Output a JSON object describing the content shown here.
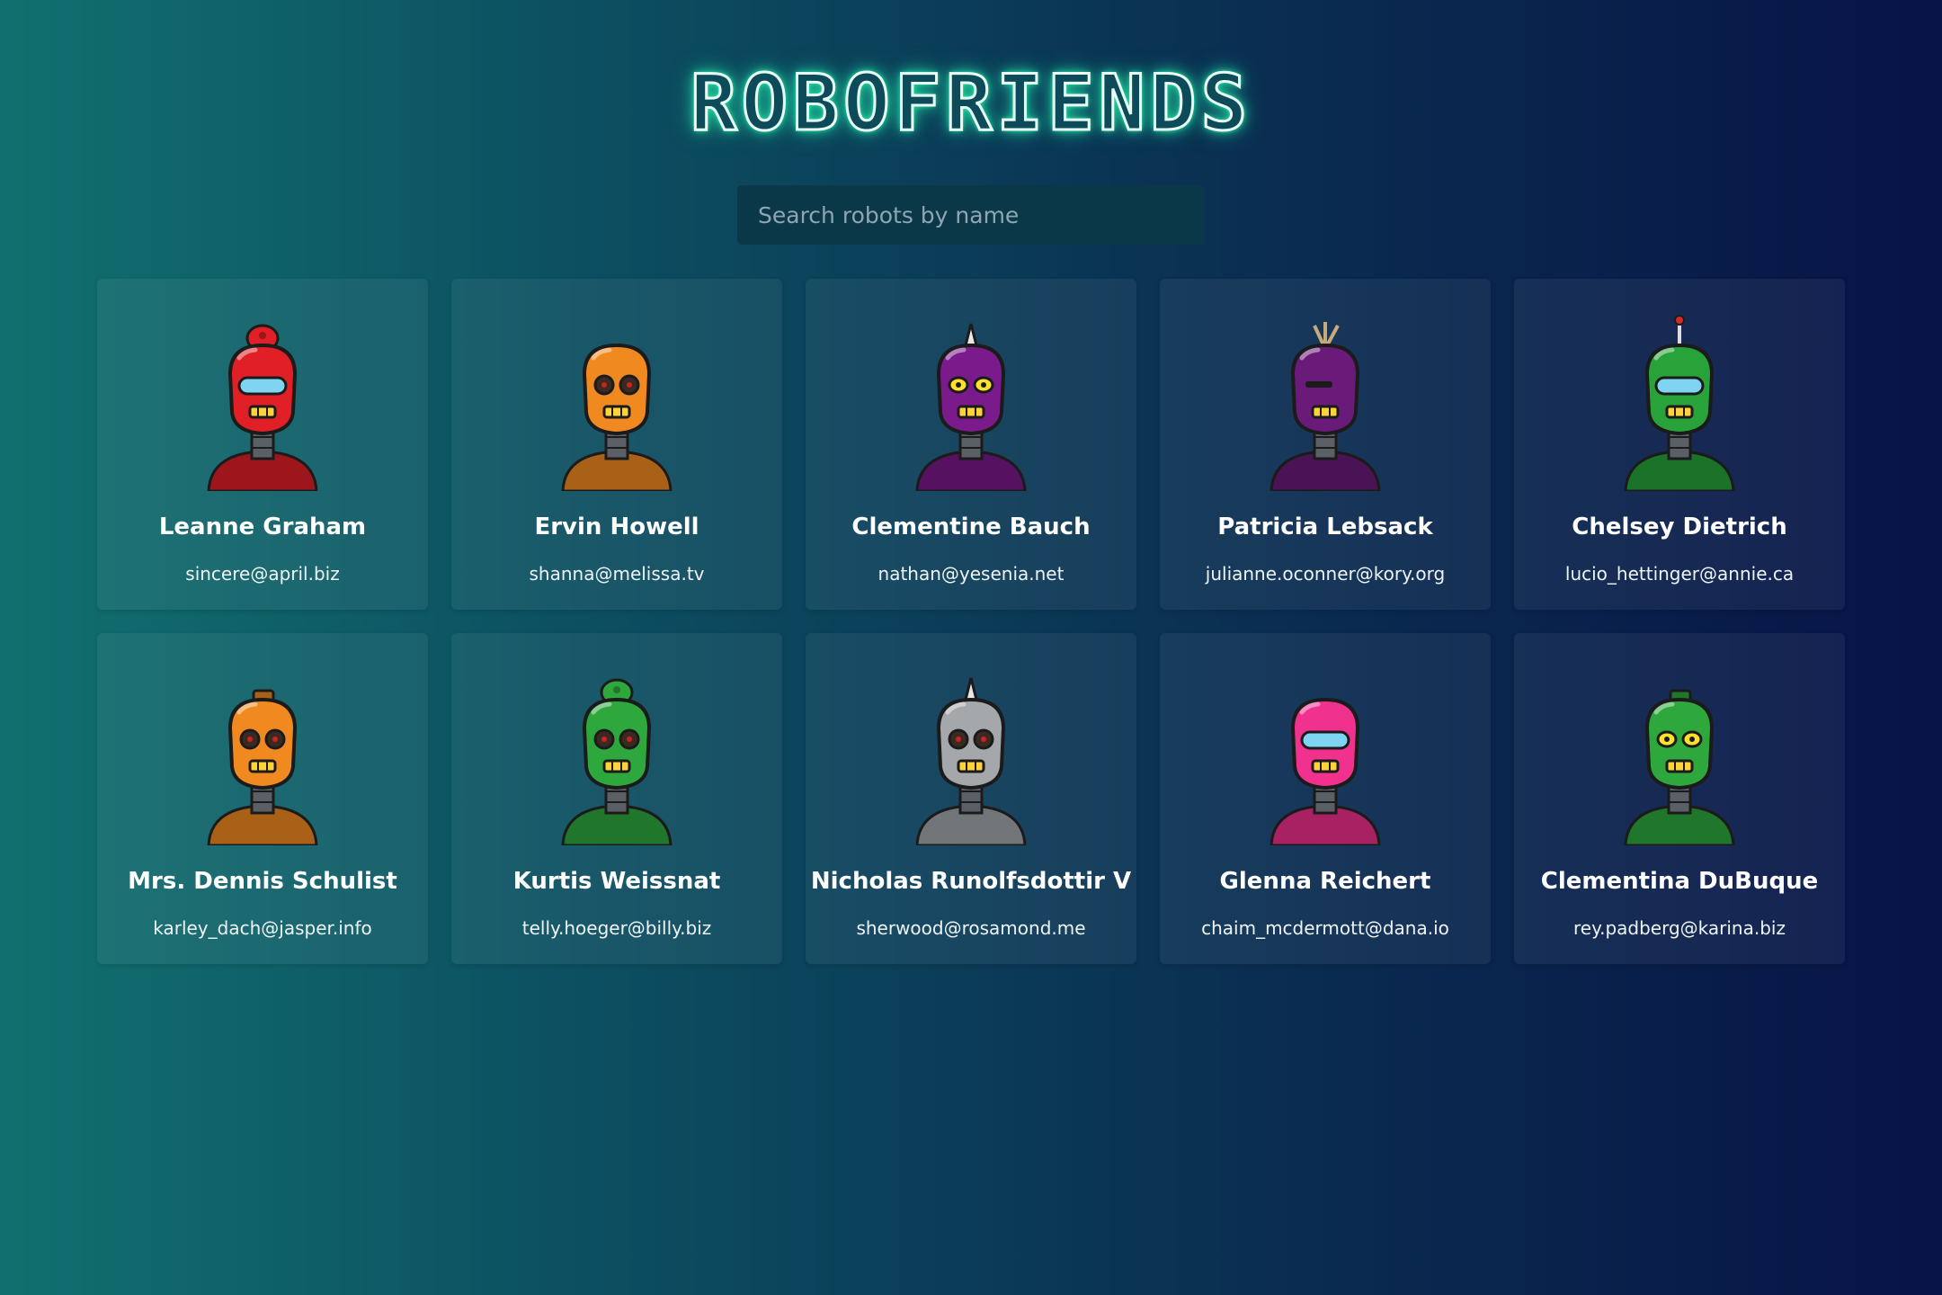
{
  "app": {
    "title": "ROBOFRIENDS"
  },
  "search": {
    "placeholder": "Search robots by name",
    "value": ""
  },
  "robots": [
    {
      "name": "Leanne Graham",
      "email": "sincere@april.biz",
      "color": "#e01f27",
      "eyes": "visor",
      "topper": "dome"
    },
    {
      "name": "Ervin Howell",
      "email": "shanna@melissa.tv",
      "color": "#f08a20",
      "eyes": "dots",
      "topper": "none"
    },
    {
      "name": "Clementine Bauch",
      "email": "nathan@yesenia.net",
      "color": "#7b1a8a",
      "eyes": "yellow",
      "topper": "spike"
    },
    {
      "name": "Patricia Lebsack",
      "email": "julianne.oconner@kory.org",
      "color": "#6a1b7a",
      "eyes": "slit",
      "topper": "wires"
    },
    {
      "name": "Chelsey Dietrich",
      "email": "lucio_hettinger@annie.ca",
      "color": "#27a33a",
      "eyes": "visor",
      "topper": "antenna"
    },
    {
      "name": "Mrs. Dennis Schulist",
      "email": "karley_dach@jasper.info",
      "color": "#f08a20",
      "eyes": "dots",
      "topper": "box"
    },
    {
      "name": "Kurtis Weissnat",
      "email": "telly.hoeger@billy.biz",
      "color": "#2ea83d",
      "eyes": "dots",
      "topper": "dome"
    },
    {
      "name": "Nicholas Runolfsdottir V",
      "email": "sherwood@rosamond.me",
      "color": "#a5a8ab",
      "eyes": "dots",
      "topper": "spike"
    },
    {
      "name": "Glenna Reichert",
      "email": "chaim_mcdermott@dana.io",
      "color": "#f0318e",
      "eyes": "visor",
      "topper": "none"
    },
    {
      "name": "Clementina DuBuque",
      "email": "rey.padberg@karina.biz",
      "color": "#2ea83d",
      "eyes": "yellow",
      "topper": "box"
    }
  ]
}
